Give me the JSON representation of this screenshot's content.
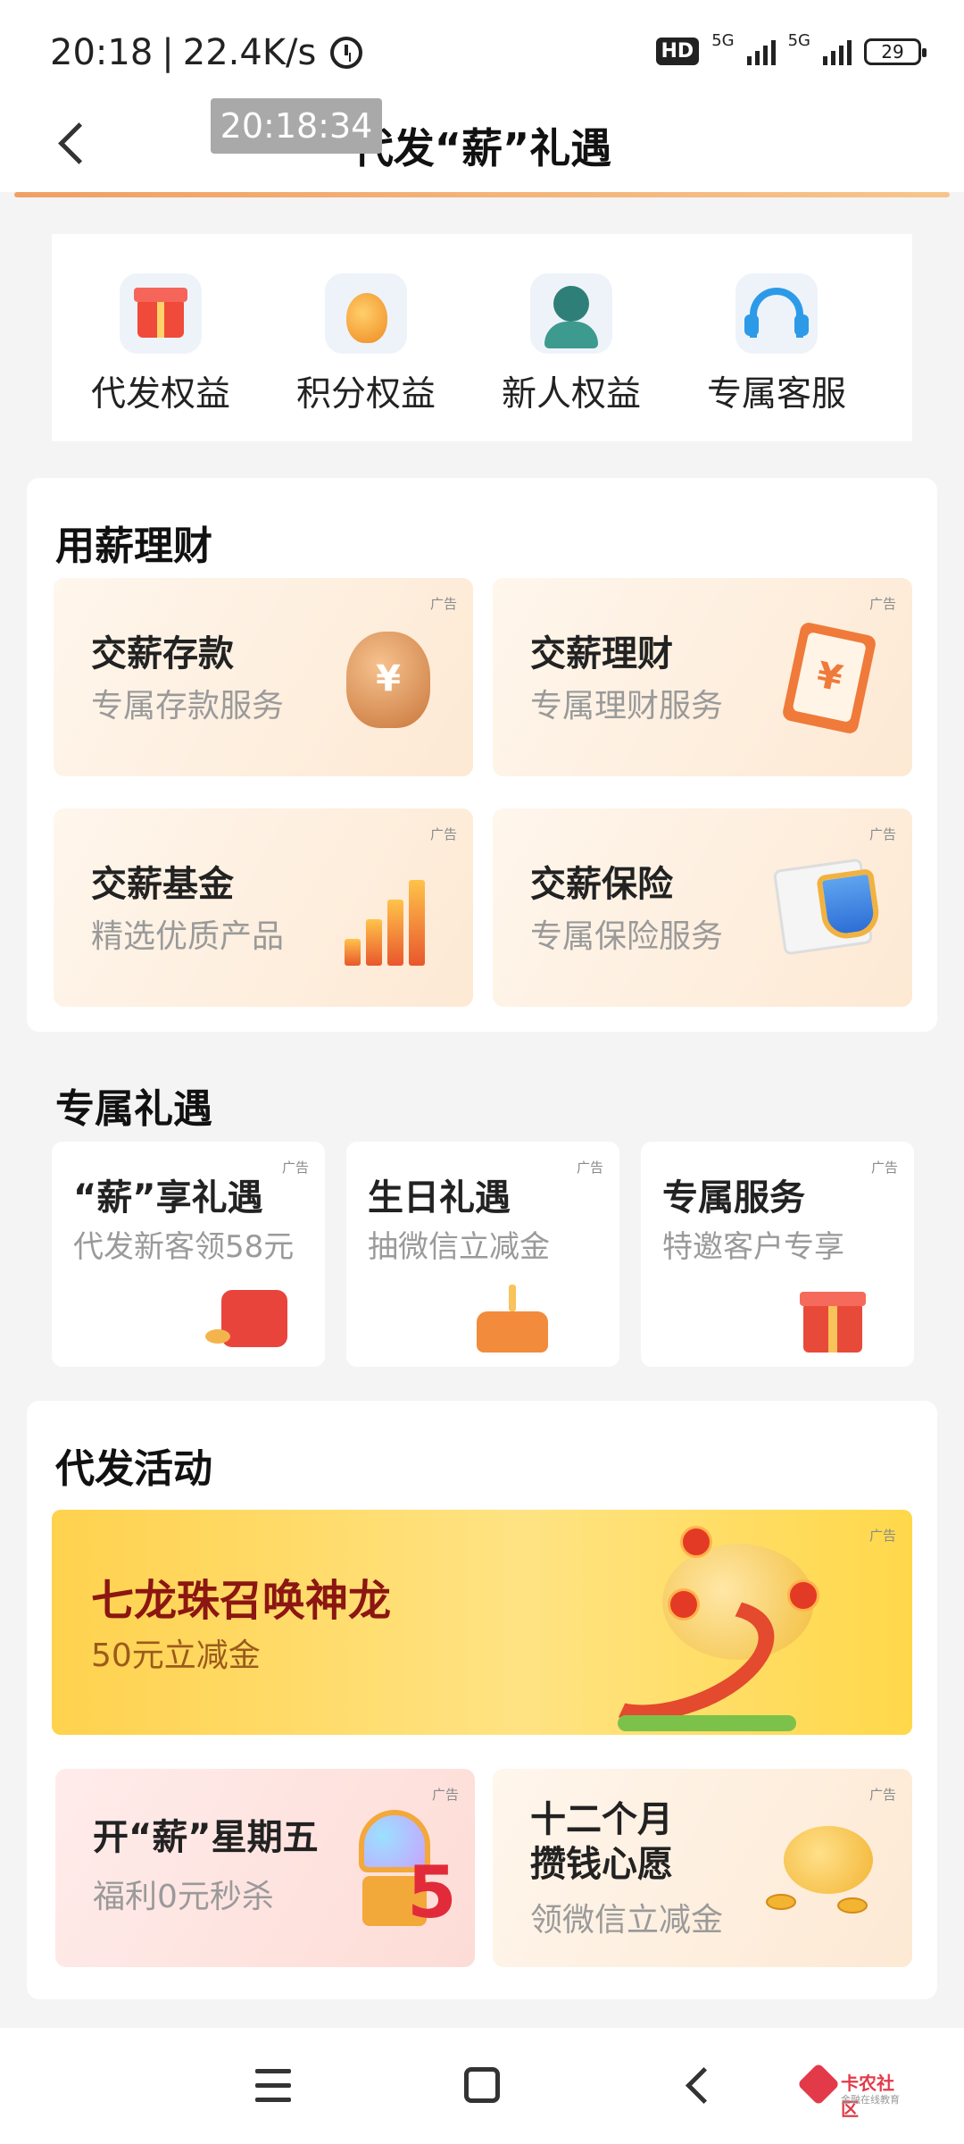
{
  "status_bar": {
    "time": "20:18",
    "speed": "22.4K/s",
    "hd": "HD",
    "network1": "5G",
    "network2": "5G",
    "battery": "29"
  },
  "header": {
    "overlay_time": "20:18:34",
    "title": "代发“薪”礼遇"
  },
  "quick_entries": [
    {
      "label": "代发权益",
      "icon": "gift-icon"
    },
    {
      "label": "积分权益",
      "icon": "money-bag-icon"
    },
    {
      "label": "新人权益",
      "icon": "person-icon"
    },
    {
      "label": "专属客服",
      "icon": "headset-icon"
    }
  ],
  "finance": {
    "title": "用薪理财",
    "ad_label": "广告",
    "items": [
      {
        "title": "交薪存款",
        "subtitle": "专属存款服务",
        "icon": "money-bag-icon"
      },
      {
        "title": "交薪理财",
        "subtitle": "专属理财服务",
        "icon": "clipboard-icon"
      },
      {
        "title": "交薪基金",
        "subtitle": "精选优质产品",
        "icon": "chart-icon"
      },
      {
        "title": "交薪保险",
        "subtitle": "专属保险服务",
        "icon": "shield-icon"
      }
    ]
  },
  "gifts": {
    "title": "专属礼遇",
    "ad_label": "广告",
    "items": [
      {
        "title": "“薪”享礼遇",
        "subtitle": "代发新客领58元",
        "icon": "wallet-icon"
      },
      {
        "title": "生日礼遇",
        "subtitle": "抽微信立减金",
        "icon": "cake-icon"
      },
      {
        "title": "专属服务",
        "subtitle": "特邀客户专享",
        "icon": "present-icon"
      }
    ]
  },
  "activities": {
    "title": "代发活动",
    "ad_label": "广告",
    "banner": {
      "title": "七龙珠召唤神龙",
      "subtitle": "50元立减金",
      "icon": "dragon-icon"
    },
    "items": [
      {
        "title": "开“薪”星期五",
        "subtitle": "福利0元秒杀",
        "icon": "gacha-icon",
        "badge": "5"
      },
      {
        "title_line1": "十二个月",
        "title_line2": "攒钱心愿",
        "subtitle": "领微信立减金",
        "icon": "piggy-bank-icon"
      }
    ]
  },
  "nav": {
    "watermark_title": "卡农社区",
    "watermark_sub": "金融在线教育"
  },
  "colors": {
    "accent_line": "#f0a064",
    "banner_title": "#8b1612",
    "card_bg": "#fdeedd"
  }
}
